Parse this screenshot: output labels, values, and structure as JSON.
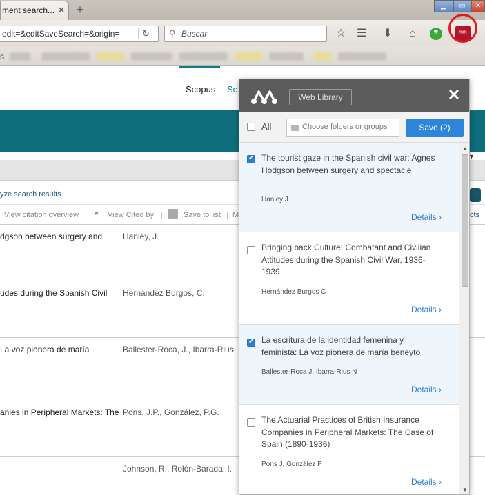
{
  "browser": {
    "tab_title": "ment search...",
    "tab_close": "✕",
    "new_tab": "+",
    "url": "edit=&editSaveSearch=&origin=",
    "search_placeholder": "Buscar",
    "bookmarks_label": "s"
  },
  "scopus": {
    "nav_scopus": "Scopus",
    "nav_sc": "Sc",
    "analyze": "yze search results",
    "actions": {
      "citation_overview": "View citation overview",
      "cited_by": "View Cited by",
      "save_to_list": "Save to list",
      "more": "M",
      "edge": "cts"
    },
    "results": [
      {
        "title": "dgson between surgery and",
        "authors": "Hanley, J."
      },
      {
        "title": "udes during the Spanish Civil",
        "authors": "Hernández Burgos, C."
      },
      {
        "title": "La voz pionera de maría",
        "authors": "Ballester-Roca, J., Ibarra-Rius,"
      },
      {
        "title": "anies in Peripheral Markets: The",
        "authors": "Pons, J.P., González, P.G."
      },
      {
        "title": "",
        "authors": "Johnson, R., Rolón-Barada, I."
      }
    ]
  },
  "mendeley": {
    "web_library": "Web Library",
    "close": "✕",
    "all_label": "All",
    "folders_placeholder": "Choose folders or groups",
    "save_button": "Save (2)",
    "details_label": "Details",
    "items": [
      {
        "title": "The tourist gaze in the Spanish civil war: Agnes Hodgson between surgery and spectacle",
        "authors": "Hanley J",
        "checked": true
      },
      {
        "title": "Bringing back Culture: Combatant and Civilian Attitudes during the Spanish Civil War, 1936-1939",
        "authors": "Hernández Burgos C",
        "checked": false
      },
      {
        "title": "La escritura de la identidad femenina y feminista: La voz pionera de maría beneyto",
        "authors": "Ballester-Roca J,   Ibarra-Rius N",
        "checked": true
      },
      {
        "title": "The Actuarial Practices of British Insurance Companies in Peripheral Markets: The Case of Spain (1890-1936)",
        "authors": "Pons J,   González P",
        "checked": false
      }
    ]
  },
  "colors": {
    "teal": "#0f6e7c",
    "mendeley_red": "#b3162b",
    "highlight_red": "#e0191f",
    "save_blue": "#2d86d9"
  }
}
